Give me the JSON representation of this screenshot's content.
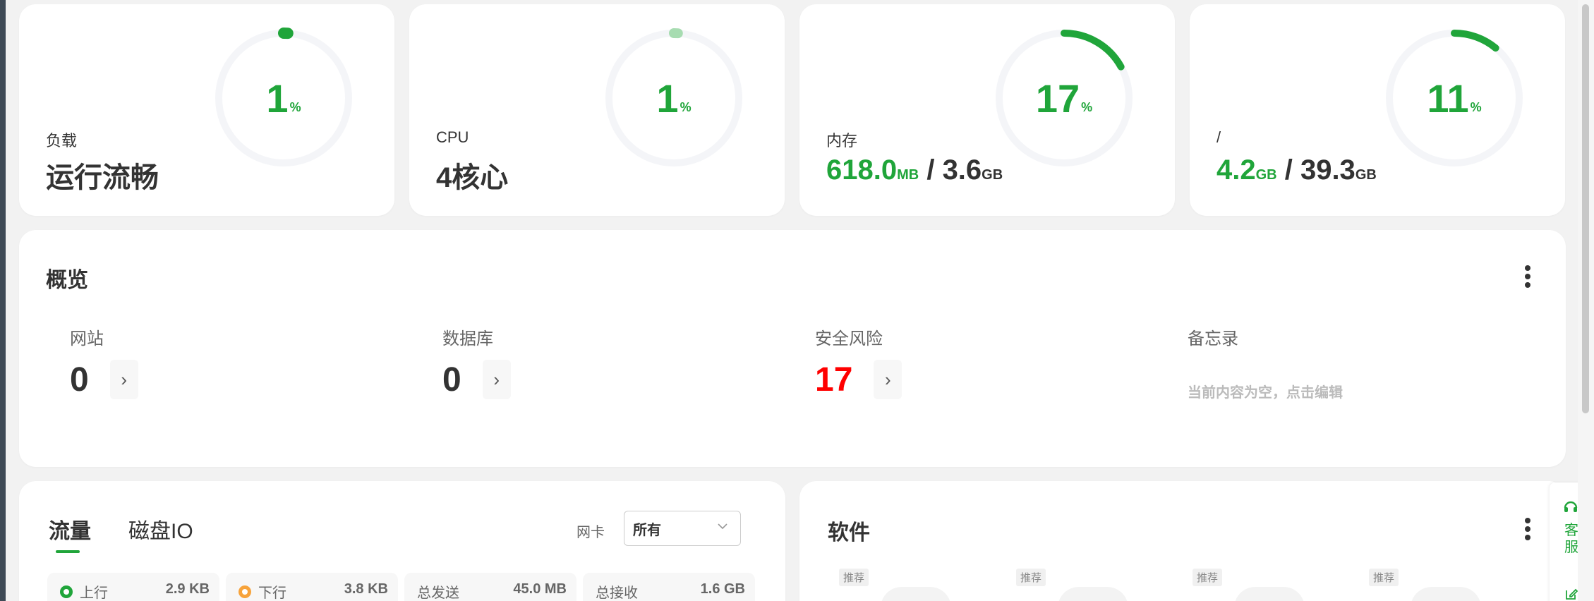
{
  "colors": {
    "accent": "#20a53a",
    "accent_light": "#a7dcb1",
    "danger": "#ff0000",
    "track": "#f4f5f8"
  },
  "stats": [
    {
      "label": "负载",
      "value": "运行流畅",
      "gauge_value": "1",
      "gauge_unit": "%",
      "percent": 1
    },
    {
      "label": "CPU",
      "value": "4核心",
      "gauge_value": "1",
      "gauge_unit": "%",
      "percent": 1
    },
    {
      "label": "内存",
      "used": "618.0",
      "used_unit": "MB",
      "sep": " / ",
      "total": "3.6",
      "total_unit": "GB",
      "gauge_value": "17",
      "gauge_unit": "%",
      "percent": 17
    },
    {
      "label": "/",
      "used": "4.2",
      "used_unit": "GB",
      "sep": " / ",
      "total": "39.3",
      "total_unit": "GB",
      "gauge_value": "11",
      "gauge_unit": "%",
      "percent": 11
    }
  ],
  "overview": {
    "title": "概览",
    "items": [
      {
        "label": "网站",
        "value": "0"
      },
      {
        "label": "数据库",
        "value": "0"
      },
      {
        "label": "安全风险",
        "value": "17"
      },
      {
        "label": "备忘录",
        "memo": "当前内容为空，点击编辑"
      }
    ],
    "arrow": "›"
  },
  "traffic": {
    "tabs": [
      "流量",
      "磁盘IO"
    ],
    "nic_label": "网卡",
    "nic_value": "所有",
    "stats": [
      {
        "label": "上行",
        "value": "2.9 KB",
        "dot_color": "#20a53a"
      },
      {
        "label": "下行",
        "value": "3.8 KB",
        "dot_color": "#f7a33b"
      },
      {
        "label": "总发送",
        "value": "45.0 MB"
      },
      {
        "label": "总接收",
        "value": "1.6 GB"
      }
    ]
  },
  "software": {
    "title": "软件",
    "badges": [
      "推荐",
      "推荐",
      "推荐",
      "推荐"
    ]
  },
  "side_widget": {
    "service_text": "客服",
    "icons": [
      "headset-icon",
      "edit-icon"
    ]
  }
}
